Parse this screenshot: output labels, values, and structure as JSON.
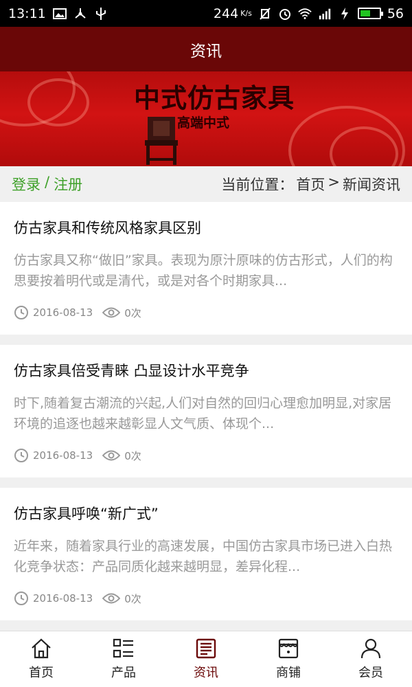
{
  "status_bar": {
    "time": "13:11",
    "net_speed": "244",
    "net_unit": "K/s",
    "battery": "56",
    "battery_level": 0.56
  },
  "header": {
    "title": "资讯"
  },
  "banner": {
    "title": "中式仿古家具",
    "subtitle": "高端中式"
  },
  "nav": {
    "login": "登录",
    "separator": "/",
    "register": "注册",
    "breadcrumb_prefix": "当前位置：",
    "breadcrumb_home": "首页",
    "breadcrumb_sep": ">",
    "breadcrumb_current": "新闻资讯"
  },
  "articles": [
    {
      "title": "仿古家具和传统风格家具区别",
      "excerpt": "仿古家具又称“做旧”家具。表现为原汁原味的仿古形式，人们的构思要按着明代或是清代，或是对各个时期家具...",
      "date": "2016-08-13",
      "views": "0次"
    },
    {
      "title": "仿古家具倍受青睐 凸显设计水平竞争",
      "excerpt": "时下,随着复古潮流的兴起,人们对自然的回归心理愈加明显,对家居环境的追逐也越来越彰显人文气质、体现个...",
      "date": "2016-08-13",
      "views": "0次"
    },
    {
      "title": "仿古家具呼唤“新广式”",
      "excerpt": "近年来，随着家具行业的高速发展，中国仿古家具市场已进入白热化竞争状态：产品同质化越来越明显，差异化程...",
      "date": "2016-08-13",
      "views": "0次"
    }
  ],
  "tabs": [
    {
      "label": "首页",
      "icon": "home-icon"
    },
    {
      "label": "产品",
      "icon": "product-list-icon"
    },
    {
      "label": "资讯",
      "icon": "news-icon",
      "active": true
    },
    {
      "label": "商铺",
      "icon": "shop-icon"
    },
    {
      "label": "会员",
      "icon": "member-icon"
    }
  ],
  "colors": {
    "header": "#6a0707",
    "accent_green": "#3fa12a",
    "active_tab": "#6a0707"
  }
}
